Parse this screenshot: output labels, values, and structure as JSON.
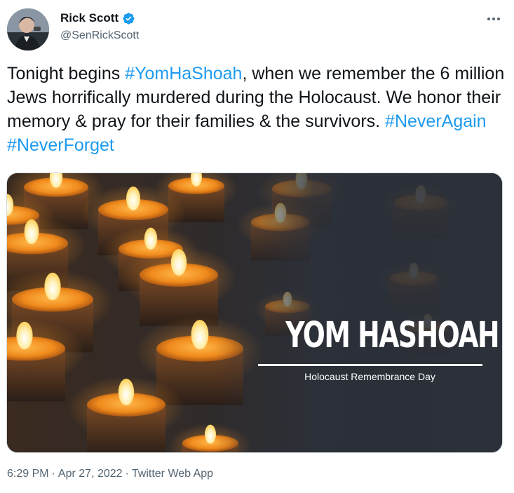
{
  "author": {
    "display_name": "Rick Scott",
    "handle": "@SenRickScott",
    "verified": true,
    "avatar_icon": "profile-photo"
  },
  "tweet": {
    "text_1": "Tonight begins ",
    "hashtag_1": "#YomHaShoah",
    "text_2": ", when we remember the 6 million Jews horrifically murdered during the Holocaust. We honor their memory & pray for their families & the survivors. ",
    "hashtag_2": "#NeverAgain",
    "hashtag_3": "#NeverForget"
  },
  "media": {
    "title": "YOM HASHOAH",
    "subtitle": "Holocaust Remembrance Day"
  },
  "meta": {
    "time": "6:29 PM",
    "date": "Apr 27, 2022",
    "source": "Twitter Web App",
    "separator": "·"
  },
  "icons": {
    "more": "more-options-icon",
    "verified": "verified-badge-icon"
  },
  "colors": {
    "link": "#1d9bf0",
    "text": "#0f1419",
    "secondary": "#536471",
    "flame": "#f7a12a"
  }
}
